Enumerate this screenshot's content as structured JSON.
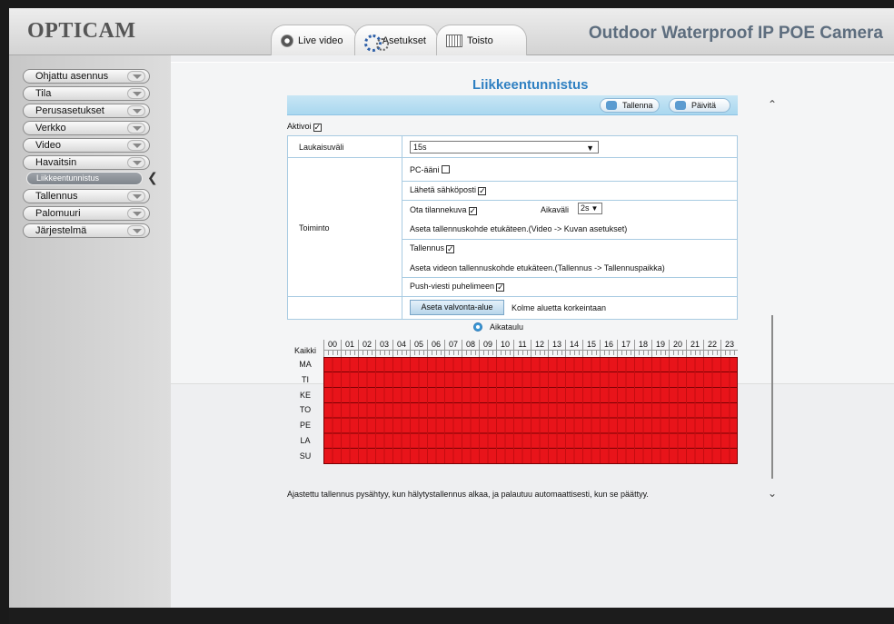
{
  "header": {
    "logo": "OPTICAM",
    "camera_title": "Outdoor Waterproof IP POE Camera",
    "tabs": [
      {
        "label": "Live video",
        "icon": "camera-icon"
      },
      {
        "label": "Asetukset",
        "icon": "gear-icon"
      },
      {
        "label": "Toisto",
        "icon": "film-icon"
      }
    ]
  },
  "sidebar": {
    "items": [
      {
        "label": "Ohjattu asennus"
      },
      {
        "label": "Tila"
      },
      {
        "label": "Perusasetukset"
      },
      {
        "label": "Verkko"
      },
      {
        "label": "Video"
      },
      {
        "label": "Havaitsin"
      },
      {
        "label": "Tallennus"
      },
      {
        "label": "Palomuuri"
      },
      {
        "label": "Järjestelmä"
      }
    ],
    "active_sub": "Liikkeentunnistus"
  },
  "page": {
    "title": "Liikkeentunnistus",
    "save_label": "Tallenna",
    "refresh_label": "Päivitä",
    "enable_label": "Aktivoi",
    "enable_checked": true
  },
  "form": {
    "trigger_interval_label": "Laukaisuväli",
    "trigger_interval_value": "15s",
    "actions_label": "Toiminto",
    "pc_sound_label": "PC-ääni",
    "pc_sound_checked": false,
    "email_label": "Lähetä sähköposti",
    "email_checked": true,
    "snapshot_label": "Ota tilannekuva",
    "snapshot_checked": true,
    "interval_label": "Aikaväli",
    "interval_value": "2s",
    "snapshot_hint": "Aseta tallennuskohde etukäteen.(Video -> Kuvan asetukset)",
    "recording_label": "Tallennus",
    "recording_checked": true,
    "recording_hint": "Aseta videon tallennuskohde etukäteen.(Tallennus -> Tallennuspaikka)",
    "push_label": "Push-viesti puhelimeen",
    "push_checked": true,
    "area_button": "Aseta valvonta-alue",
    "area_hint": "Kolme aluetta korkeintaan"
  },
  "schedule": {
    "title": "Aikataulu",
    "all_label": "Kaikki",
    "hours": [
      "00",
      "01",
      "02",
      "03",
      "04",
      "05",
      "06",
      "07",
      "08",
      "09",
      "10",
      "11",
      "12",
      "13",
      "14",
      "15",
      "16",
      "17",
      "18",
      "19",
      "20",
      "21",
      "22",
      "23"
    ],
    "days": [
      "MA",
      "TI",
      "KE",
      "TO",
      "PE",
      "LA",
      "SU"
    ],
    "all_selected": true,
    "selected_color": "#e8141a"
  },
  "note": "Ajastettu tallennus pysähtyy, kun hälytystallennus alkaa, ja palautuu automaattisesti, kun se päättyy.",
  "colors": {
    "title_blue": "#2f80c2",
    "toolbar_blue": "#a9d7ef",
    "schedule_red": "#e8141a"
  }
}
